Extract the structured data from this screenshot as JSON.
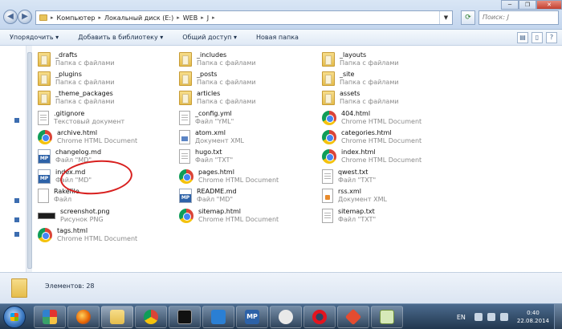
{
  "window": {
    "breadcrumbs": [
      "Компьютер",
      "Локальный диск (E:)",
      "WEB",
      "J"
    ],
    "search_placeholder": "Поиск: J",
    "controls": {
      "minimize": "─",
      "maximize": "❐",
      "close": "✕"
    }
  },
  "toolbar": {
    "items": [
      "Упорядочить ▾",
      "Добавить в библиотеку ▾",
      "Общий доступ ▾",
      "Новая папка"
    ]
  },
  "files": [
    {
      "name": "_drafts",
      "type": "Папка с файлами",
      "icon": "folder-icon"
    },
    {
      "name": "_plugins",
      "type": "Папка с файлами",
      "icon": "folder-icon"
    },
    {
      "name": "_theme_packages",
      "type": "Папка с файлами",
      "icon": "folder-icon"
    },
    {
      "name": ".gitignore",
      "type": "Текстовый документ",
      "icon": "text-document-icon"
    },
    {
      "name": "archive.html",
      "type": "Chrome HTML Document",
      "icon": "chrome-icon"
    },
    {
      "name": "changelog.md",
      "type": "Файл \"MD\"",
      "icon": "markdown-file-icon"
    },
    {
      "name": "index.md",
      "type": "Файл \"MD\"",
      "icon": "markdown-file-icon"
    },
    {
      "name": "Rakefile",
      "type": "Файл",
      "icon": "blank-file-icon"
    },
    {
      "name": "screenshot.png",
      "type": "Рисунок PNG",
      "icon": "png-image-icon"
    },
    {
      "name": "tags.html",
      "type": "Chrome HTML Document",
      "icon": "chrome-icon"
    },
    {
      "name": "_includes",
      "type": "Папка с файлами",
      "icon": "folder-icon"
    },
    {
      "name": "_posts",
      "type": "Папка с файлами",
      "icon": "folder-icon"
    },
    {
      "name": "articles",
      "type": "Папка с файлами",
      "icon": "folder-icon"
    },
    {
      "name": "_config.yml",
      "type": "Файл \"YML\"",
      "icon": "text-document-icon"
    },
    {
      "name": "atom.xml",
      "type": "Документ XML",
      "icon": "xml-file-icon"
    },
    {
      "name": "hugo.txt",
      "type": "Файл \"TXT\"",
      "icon": "text-document-icon"
    },
    {
      "name": "pages.html",
      "type": "Chrome HTML Document",
      "icon": "chrome-icon"
    },
    {
      "name": "README.md",
      "type": "Файл \"MD\"",
      "icon": "markdown-file-icon"
    },
    {
      "name": "sitemap.html",
      "type": "Chrome HTML Document",
      "icon": "chrome-icon"
    },
    {
      "name": "_layouts",
      "type": "Папка с файлами",
      "icon": "folder-icon"
    },
    {
      "name": "_site",
      "type": "Папка с файлами",
      "icon": "folder-icon"
    },
    {
      "name": "assets",
      "type": "Папка с файлами",
      "icon": "folder-icon"
    },
    {
      "name": "404.html",
      "type": "Chrome HTML Document",
      "icon": "chrome-icon"
    },
    {
      "name": "categories.html",
      "type": "Chrome HTML Document",
      "icon": "chrome-icon"
    },
    {
      "name": "index.html",
      "type": "Chrome HTML Document",
      "icon": "chrome-icon"
    },
    {
      "name": "qwest.txt",
      "type": "Файл \"TXT\"",
      "icon": "text-document-icon"
    },
    {
      "name": "rss.xml",
      "type": "Документ XML",
      "icon": "rss-file-icon"
    },
    {
      "name": "sitemap.txt",
      "type": "Файл \"TXT\"",
      "icon": "text-document-icon"
    }
  ],
  "status": {
    "item_count": "Элементов: 28"
  },
  "taskbar": {
    "language": "EN",
    "time": "0:40",
    "date": "22.08.2014",
    "apps": [
      "tiles-app-icon",
      "firefox-icon",
      "explorer-icon",
      "chrome-icon",
      "cmd-icon",
      "maxthon-icon",
      "markdownpad-icon",
      "miranda-icon",
      "opera-icon",
      "git-icon",
      "notepad-icon"
    ]
  },
  "colors": {
    "annotation": "#d8201f",
    "taskbar": "#2b4563"
  }
}
